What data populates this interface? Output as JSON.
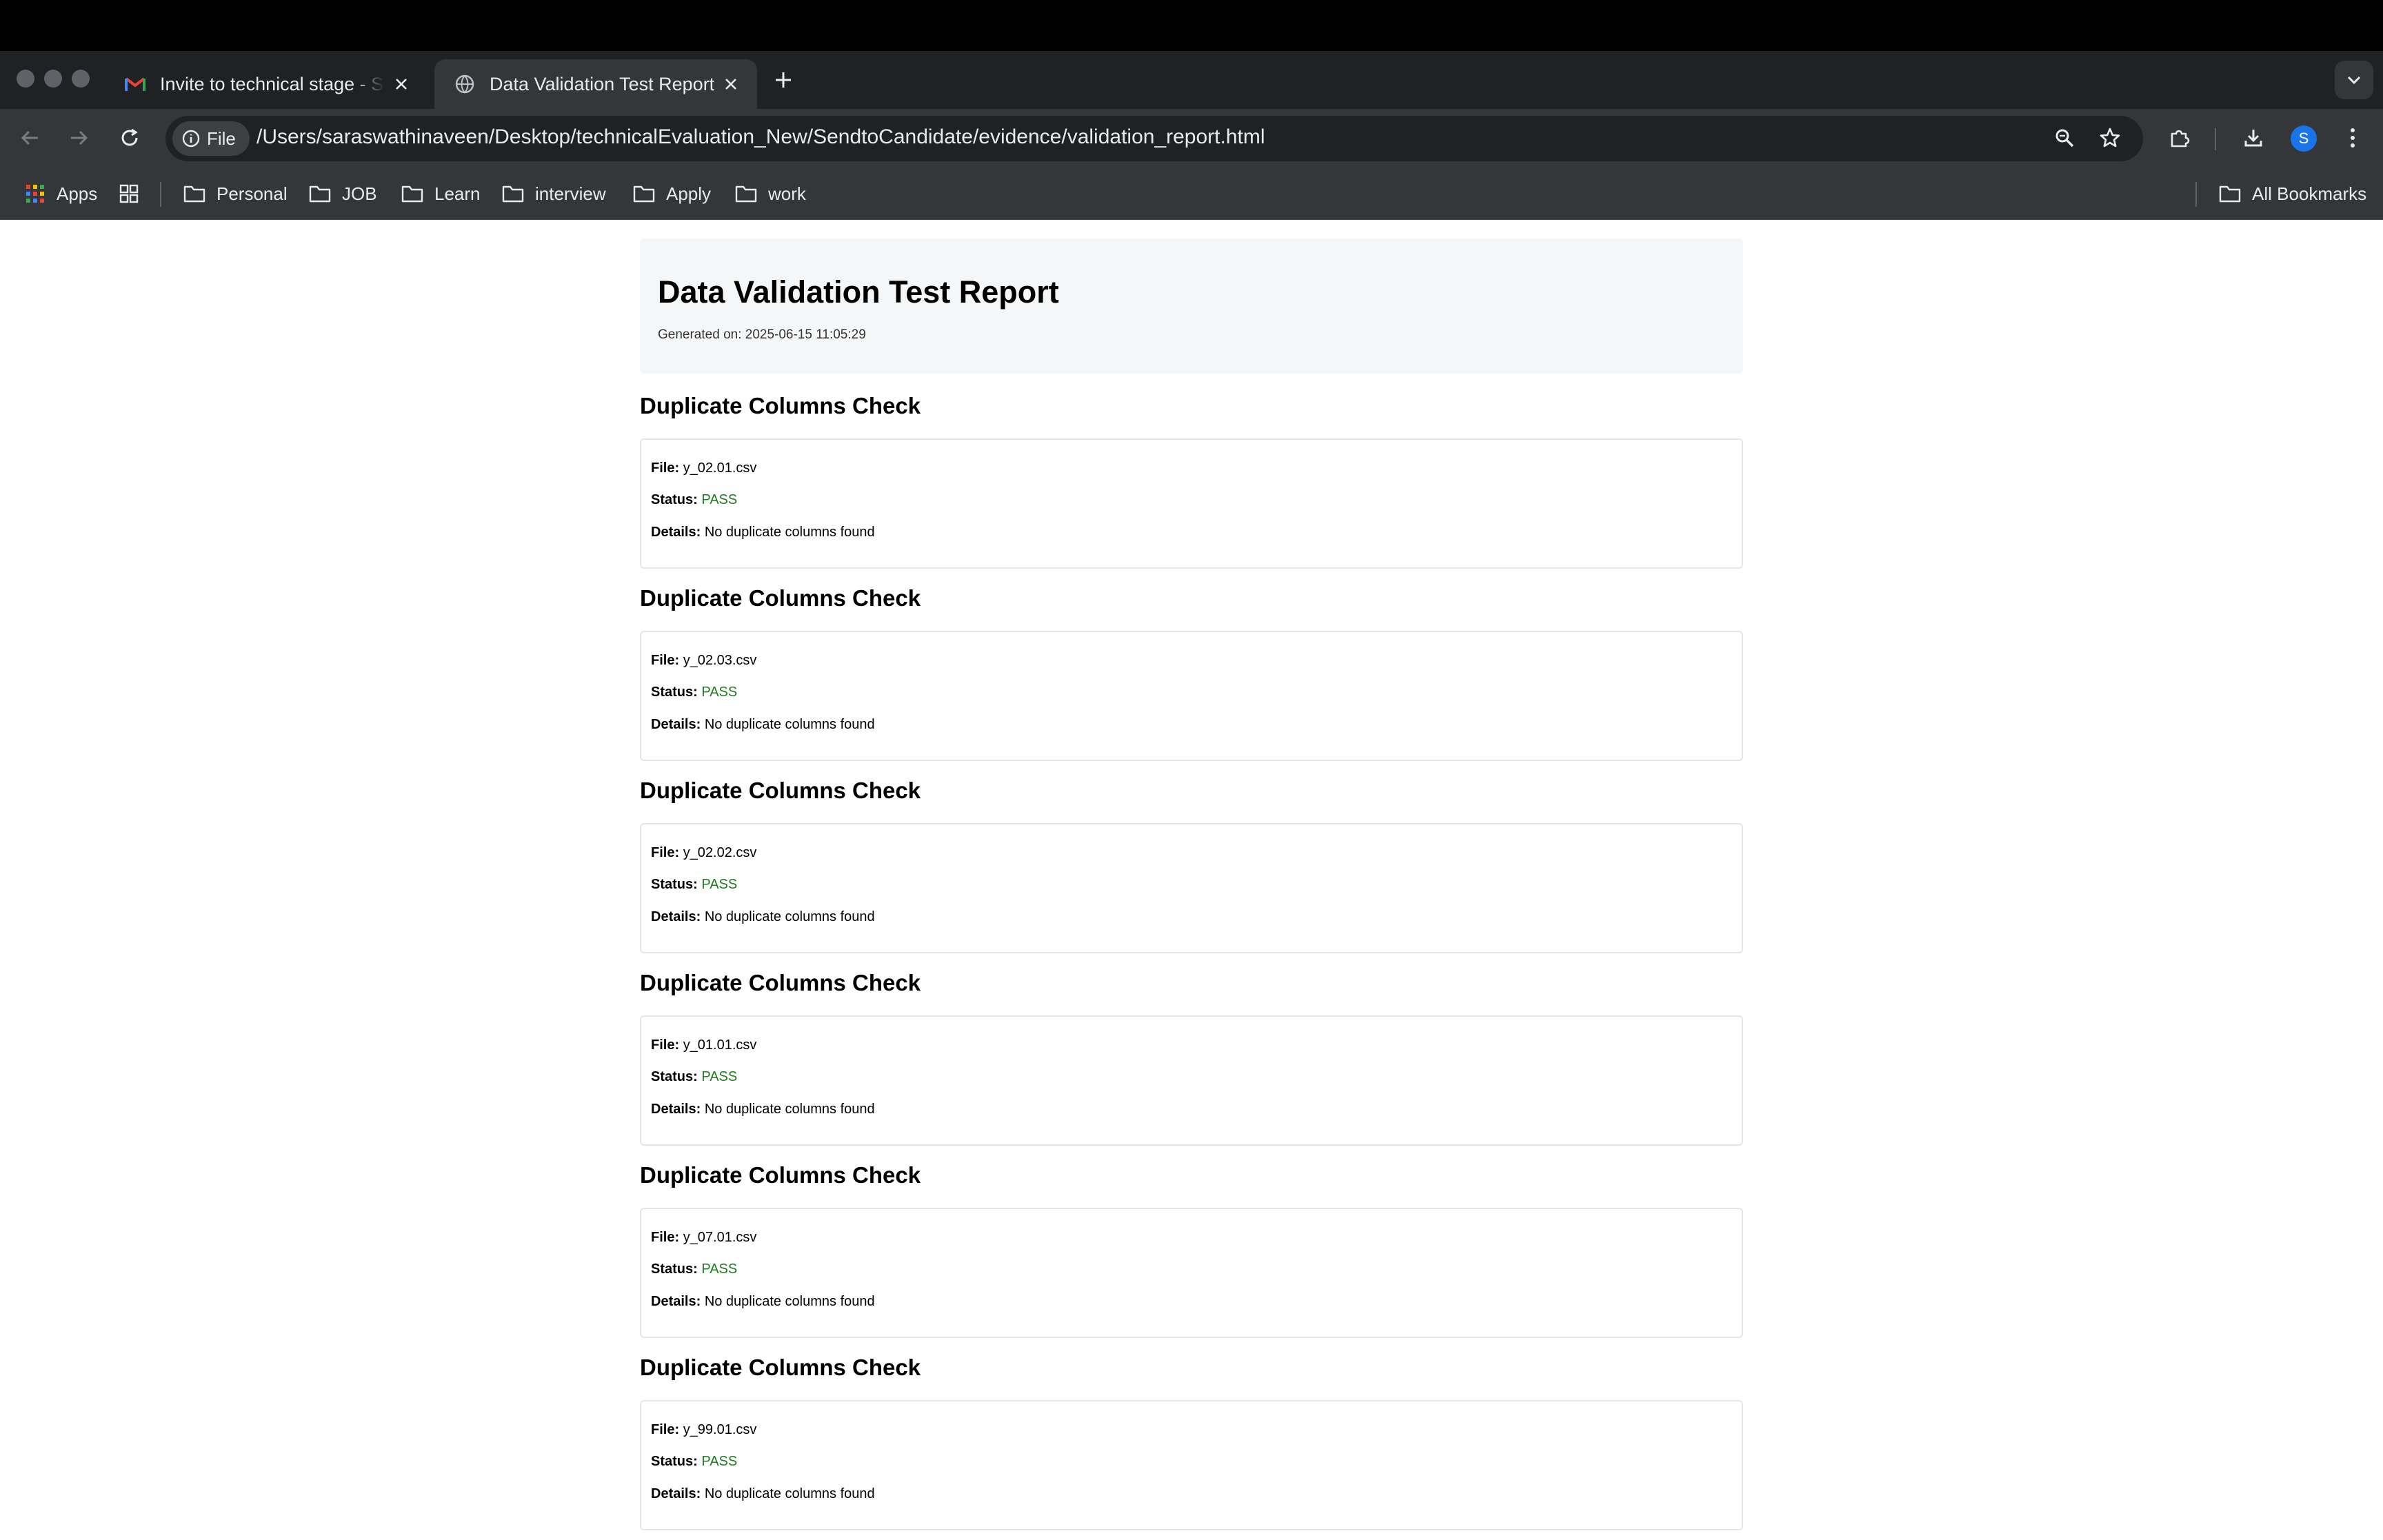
{
  "browser": {
    "tabs": [
      {
        "title": "Invite to technical stage - Sendto Candidate",
        "icon": "gmail-icon",
        "active": false
      },
      {
        "title": "Data Validation Test Report",
        "icon": "globe-icon",
        "active": true
      }
    ],
    "address_bar": {
      "scheme_label": "File",
      "url": "/Users/saraswathinaveen/Desktop/technicalEvaluation_New/SendtoCandidate/evidence/validation_report.html"
    },
    "profile_initial": "S",
    "bookmarks": [
      {
        "label": "Apps",
        "icon": "apps-grid-icon"
      },
      {
        "label": "Personal",
        "icon": "folder-icon"
      },
      {
        "label": "JOB",
        "icon": "folder-icon"
      },
      {
        "label": "Learn",
        "icon": "folder-icon"
      },
      {
        "label": "interview",
        "icon": "folder-icon"
      },
      {
        "label": "Apply",
        "icon": "folder-icon"
      },
      {
        "label": "work",
        "icon": "folder-icon"
      }
    ],
    "all_bookmarks_label": "All Bookmarks"
  },
  "report": {
    "title": "Data Validation Test Report",
    "generated": "Generated on: 2025-06-15 11:05:29",
    "labels": {
      "file": "File:",
      "status": "Status:",
      "details": "Details:"
    },
    "checks": [
      {
        "heading": "Duplicate Columns Check",
        "file": "y_02.01.csv",
        "status": "PASS",
        "details": "No duplicate columns found"
      },
      {
        "heading": "Duplicate Columns Check",
        "file": "y_02.03.csv",
        "status": "PASS",
        "details": "No duplicate columns found"
      },
      {
        "heading": "Duplicate Columns Check",
        "file": "y_02.02.csv",
        "status": "PASS",
        "details": "No duplicate columns found"
      },
      {
        "heading": "Duplicate Columns Check",
        "file": "y_01.01.csv",
        "status": "PASS",
        "details": "No duplicate columns found"
      },
      {
        "heading": "Duplicate Columns Check",
        "file": "y_07.01.csv",
        "status": "PASS",
        "details": "No duplicate columns found"
      },
      {
        "heading": "Duplicate Columns Check",
        "file": "y_99.01.csv",
        "status": "PASS",
        "details": "No duplicate columns found"
      }
    ]
  },
  "colors": {
    "pass": "#1e7d1e",
    "tab_active": "#35363a",
    "tabstrip": "#202124",
    "avatar": "#1a73e8"
  }
}
